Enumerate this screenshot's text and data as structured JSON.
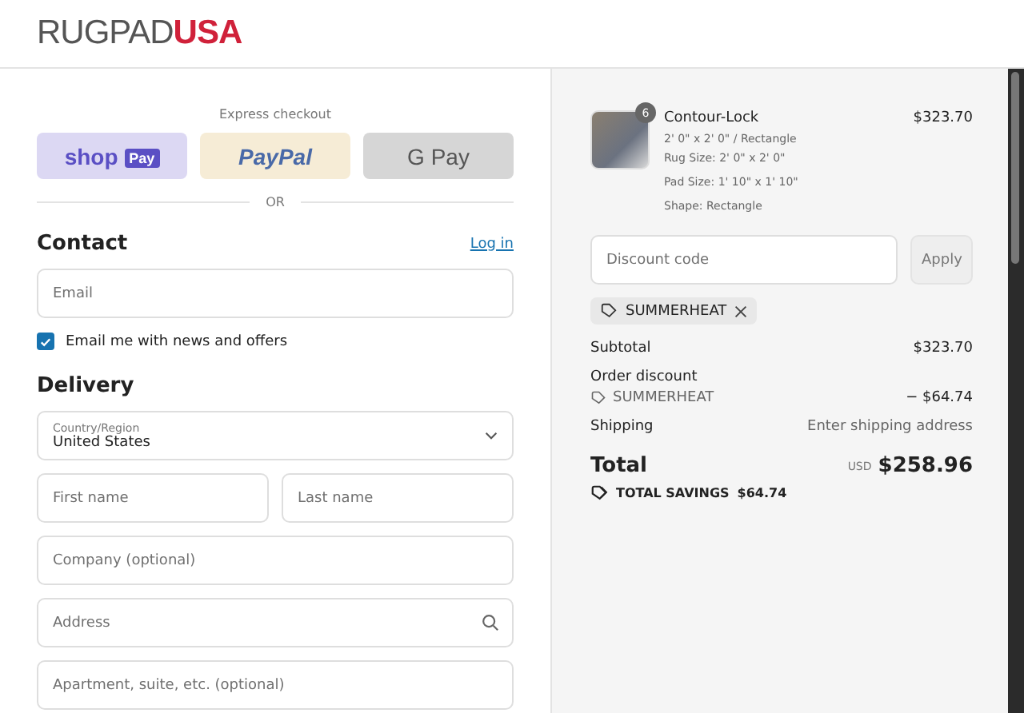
{
  "logo": {
    "part1": "RUGPAD",
    "part2": "USA"
  },
  "express": {
    "title": "Express checkout",
    "buttons": [
      {
        "kind": "shop",
        "text": "shop",
        "badge": "Pay"
      },
      {
        "kind": "paypal",
        "text": "PayPal"
      },
      {
        "kind": "gpay",
        "text": "G Pay"
      }
    ],
    "divider": "OR"
  },
  "contact": {
    "title": "Contact",
    "login": "Log in",
    "email_placeholder": "Email",
    "newsletter": {
      "label": "Email me with news and offers",
      "checked": true
    }
  },
  "delivery": {
    "title": "Delivery",
    "country": {
      "label": "Country/Region",
      "value": "United States"
    },
    "fields": [
      {
        "kind": "half",
        "placeholder": "First name"
      },
      {
        "kind": "half",
        "placeholder": "Last name"
      },
      {
        "kind": "full",
        "placeholder": "Company (optional)"
      },
      {
        "kind": "search",
        "placeholder": "Address"
      },
      {
        "kind": "full",
        "placeholder": "Apartment, suite, etc. (optional)"
      }
    ]
  },
  "summary": {
    "product": {
      "quantity": "6",
      "name": "Contour-Lock",
      "price": "$323.70",
      "details": [
        "2' 0\" x 2' 0\" / Rectangle",
        "Rug Size: 2' 0\" x 2' 0\"",
        "Pad Size: 1' 10\" x 1' 10\"",
        "Shape: Rectangle"
      ]
    },
    "discount_placeholder": "Discount code",
    "apply": "Apply",
    "applied_code": "SUMMERHEAT",
    "subtotal": {
      "label": "Subtotal",
      "value": "$323.70"
    },
    "order_discount": {
      "label": "Order discount",
      "code": "SUMMERHEAT",
      "value": "− $64.74"
    },
    "shipping": {
      "label": "Shipping",
      "value": "Enter shipping address"
    },
    "total": {
      "label": "Total",
      "currency": "USD",
      "value": "$258.96"
    },
    "savings": {
      "label": "TOTAL SAVINGS",
      "value": "$64.74"
    }
  }
}
